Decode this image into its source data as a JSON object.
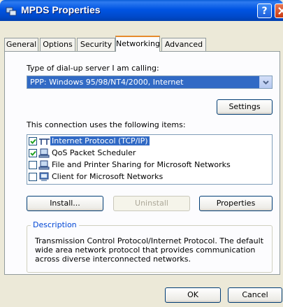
{
  "window": {
    "title": "MPDS Properties"
  },
  "tabs": [
    {
      "label": "General"
    },
    {
      "label": "Options"
    },
    {
      "label": "Security"
    },
    {
      "label": "Networking",
      "active": true
    },
    {
      "label": "Advanced"
    }
  ],
  "networking": {
    "server_type_label": "Type of dial-up server I am calling:",
    "server_type_value": "PPP: Windows 95/98/NT4/2000, Internet",
    "settings_label": "Settings",
    "items_label": "This connection uses the following items:",
    "items": [
      {
        "label": "Internet Protocol (TCP/IP)",
        "checked": true,
        "selected": true,
        "icon": "network-protocol-icon"
      },
      {
        "label": "QoS Packet Scheduler",
        "checked": true,
        "icon": "network-service-icon"
      },
      {
        "label": "File and Printer Sharing for Microsoft Networks",
        "checked": false,
        "icon": "network-service-icon"
      },
      {
        "label": "Client for Microsoft Networks",
        "checked": false,
        "icon": "network-client-icon"
      }
    ],
    "install_label": "Install...",
    "uninstall_label": "Uninstall",
    "properties_label": "Properties",
    "description_title": "Description",
    "description_text": "Transmission Control Protocol/Internet Protocol. The default wide area network protocol that provides communication across diverse interconnected networks."
  },
  "footer": {
    "ok_label": "OK",
    "cancel_label": "Cancel"
  },
  "colors": {
    "selection": "#316AC5",
    "titlebar": "#0054E3",
    "face": "#ECE9D8",
    "active_tab_accent": "#E68B2C",
    "group_title": "#0046D5"
  }
}
